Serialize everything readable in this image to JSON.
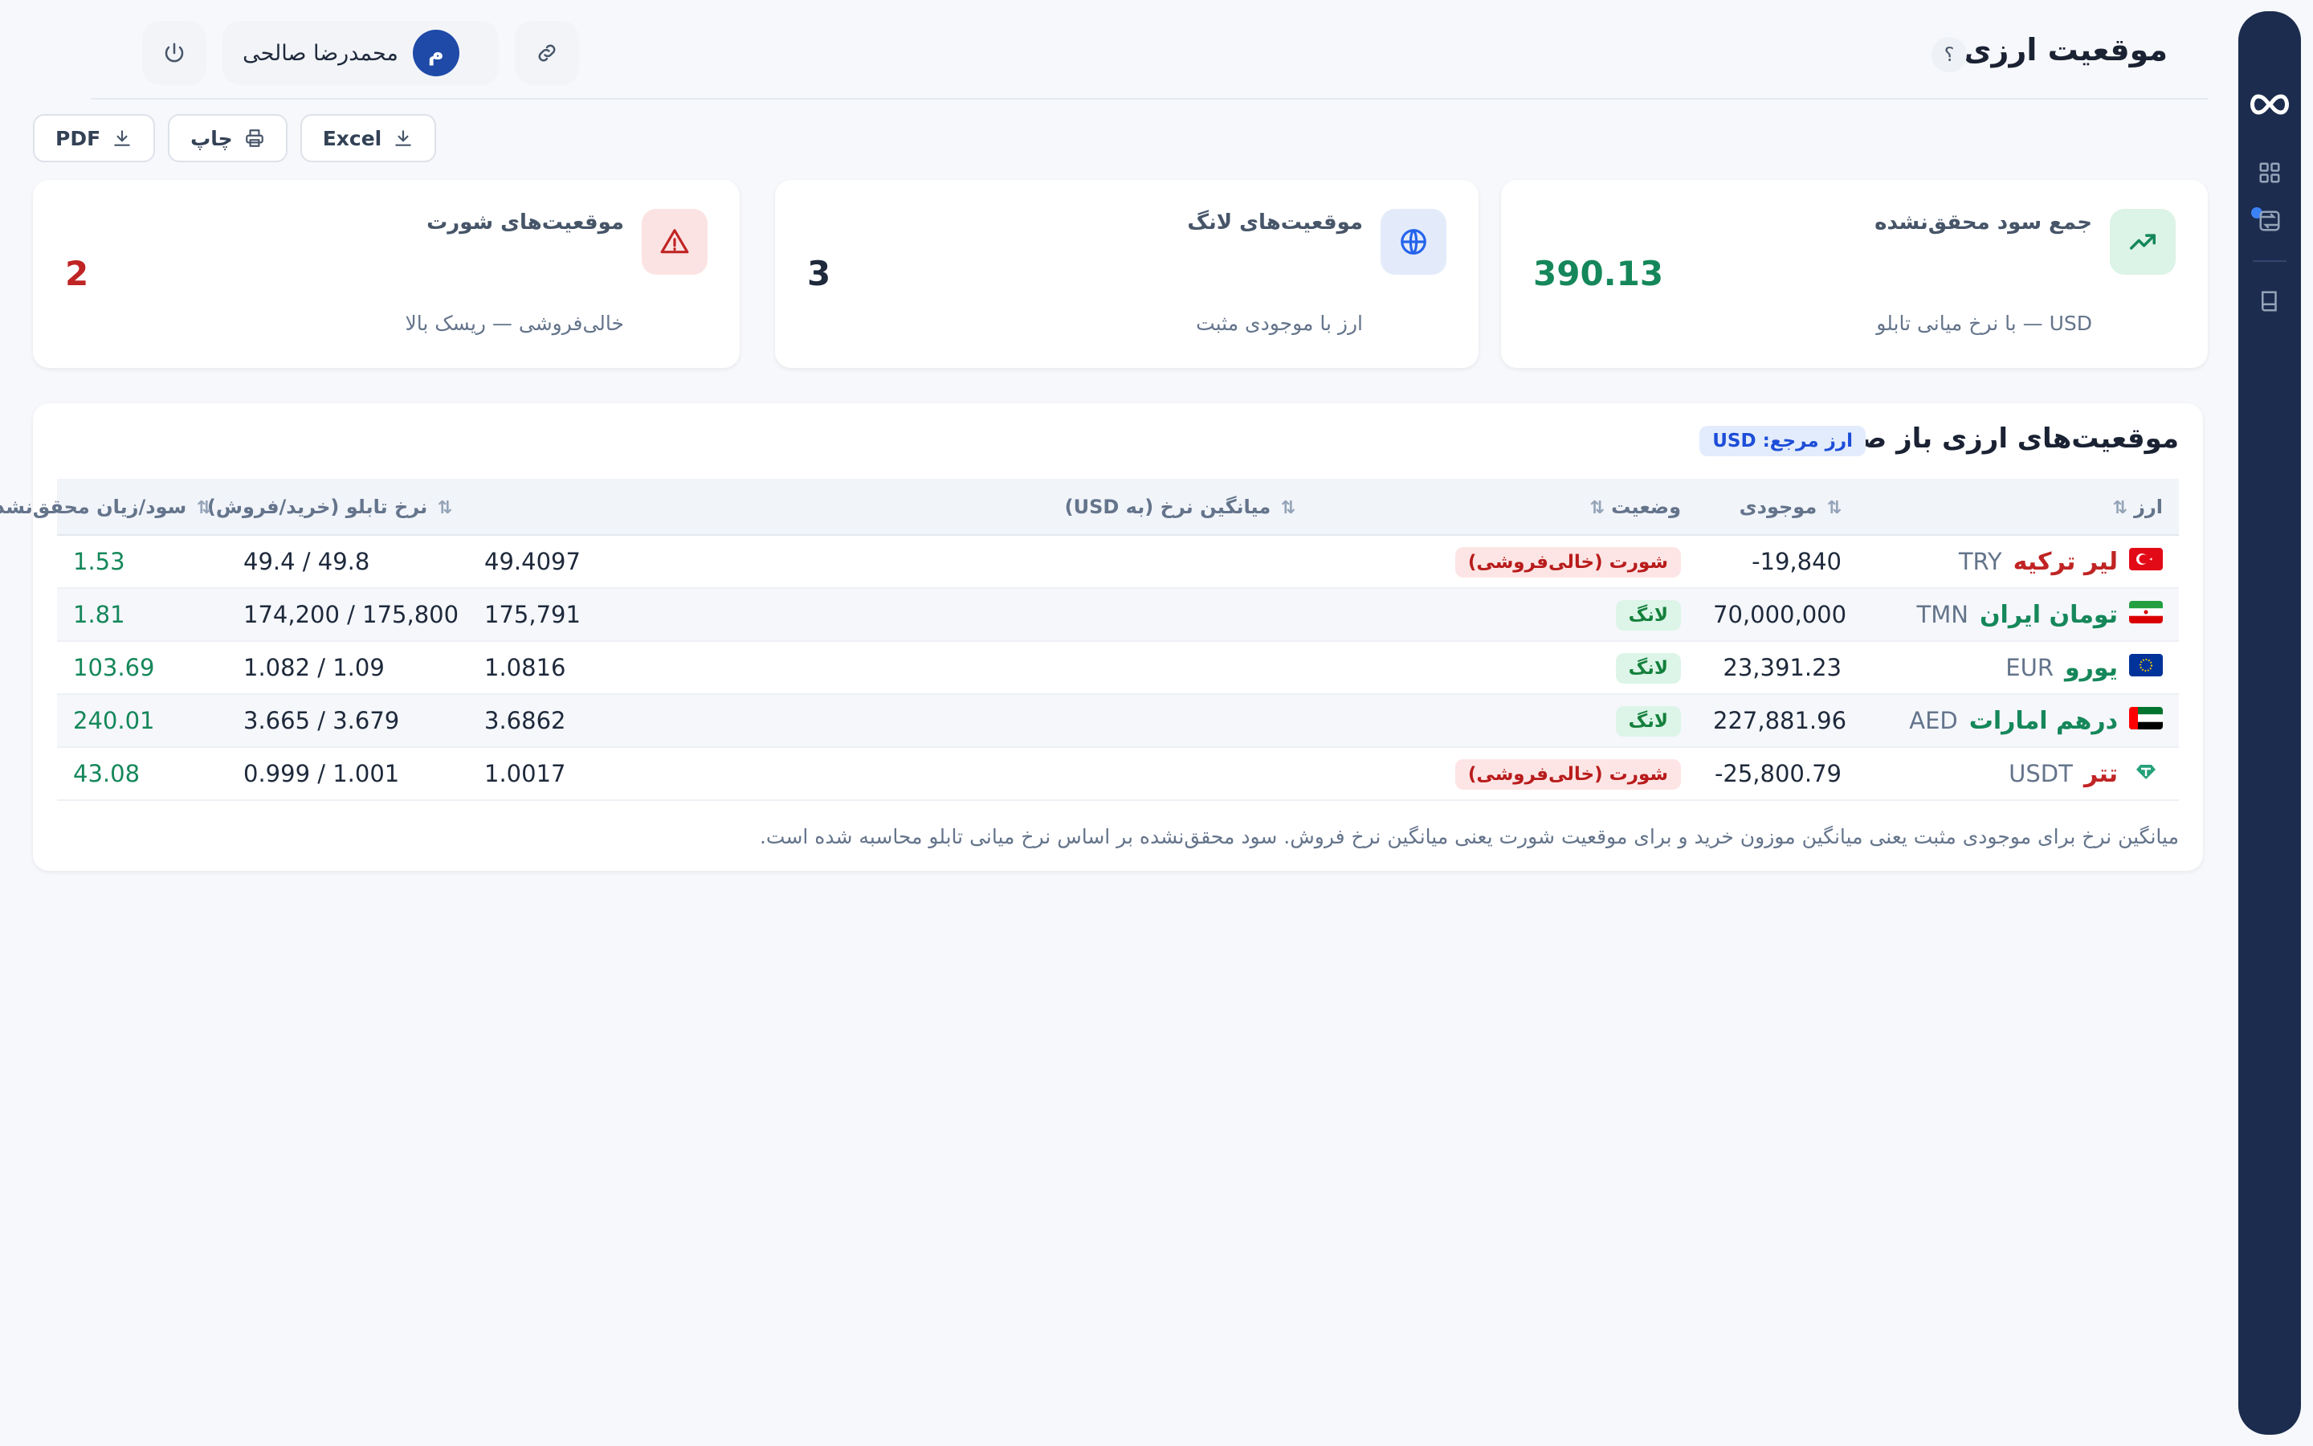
{
  "header": {
    "title": "موقعیت ارزی",
    "help_label": "؟",
    "user_name": "محمدرضا صالحی",
    "avatar_initial": "م"
  },
  "toolbar": {
    "excel_label": "Excel",
    "print_label": "چاپ",
    "pdf_label": "PDF"
  },
  "cards": {
    "profit": {
      "title": "جمع سود محقق‌نشده",
      "value": "390.13",
      "subtitle": "USD — با نرخ میانی تابلو",
      "icon": "trending-up-icon",
      "color": "#15875a"
    },
    "long": {
      "title": "موقعیت‌های لانگ",
      "value": "3",
      "subtitle": "ارز با موجودی مثبت",
      "icon": "globe-icon",
      "color": "#1e293b"
    },
    "short": {
      "title": "موقعیت‌های شورت",
      "value": "2",
      "subtitle": "خالی‌فروشی — ریسک بالا",
      "icon": "warning-icon",
      "color": "#c02424"
    }
  },
  "table": {
    "title": "موقعیت‌های ارزی باز صرافی",
    "reference_badge": "ارز مرجع: USD",
    "columns": {
      "currency": "ارز",
      "balance": "موجودی",
      "status": "وضعیت",
      "avg_rate": "میانگین نرخ (به USD)",
      "board_rate": "نرخ تابلو (خرید/فروش)",
      "pnl": "سود/زیان محقق‌نشده"
    },
    "rows": [
      {
        "name": "لیر ترکیه",
        "code": "TRY",
        "flag": "turkey-flag",
        "name_color": "#c02424",
        "balance": "‎-19,840",
        "status": "شورت (خالی‌فروشی)",
        "status_type": "short",
        "avg_rate": "49.4097",
        "board_rate": "49.4 / 49.8",
        "pnl": "1.53"
      },
      {
        "name": "تومان ایران",
        "code": "TMN",
        "flag": "iran-flag",
        "name_color": "#15875a",
        "balance": "70,000,000",
        "status": "لانگ",
        "status_type": "long",
        "avg_rate": "175,791",
        "board_rate": "174,200 / 175,800",
        "pnl": "1.81"
      },
      {
        "name": "یورو",
        "code": "EUR",
        "flag": "eu-flag",
        "name_color": "#15875a",
        "balance": "23,391.23",
        "status": "لانگ",
        "status_type": "long",
        "avg_rate": "1.0816",
        "board_rate": "1.082 / 1.09",
        "pnl": "103.69"
      },
      {
        "name": "درهم امارات",
        "code": "AED",
        "flag": "uae-flag",
        "name_color": "#15875a",
        "balance": "227,881.96",
        "status": "لانگ",
        "status_type": "long",
        "avg_rate": "3.6862",
        "board_rate": "3.665 / 3.679",
        "pnl": "240.01"
      },
      {
        "name": "تتر",
        "code": "USDT",
        "flag": "tether-icon",
        "name_color": "#c02424",
        "balance": "‎-25,800.79",
        "status": "شورت (خالی‌فروشی)",
        "status_type": "short",
        "avg_rate": "1.0017",
        "board_rate": "0.999 / 1.001",
        "pnl": "43.08"
      }
    ],
    "footnote": "میانگین نرخ برای موجودی مثبت یعنی میانگین موزون خرید و برای موقعیت شورت یعنی میانگین نرخ فروش. سود محقق‌نشده بر اساس نرخ میانی تابلو محاسبه شده است."
  },
  "colors": {
    "rail": "#1b2c4e",
    "positive": "#15875a",
    "negative": "#c02424",
    "accent": "#1f4aa8"
  }
}
